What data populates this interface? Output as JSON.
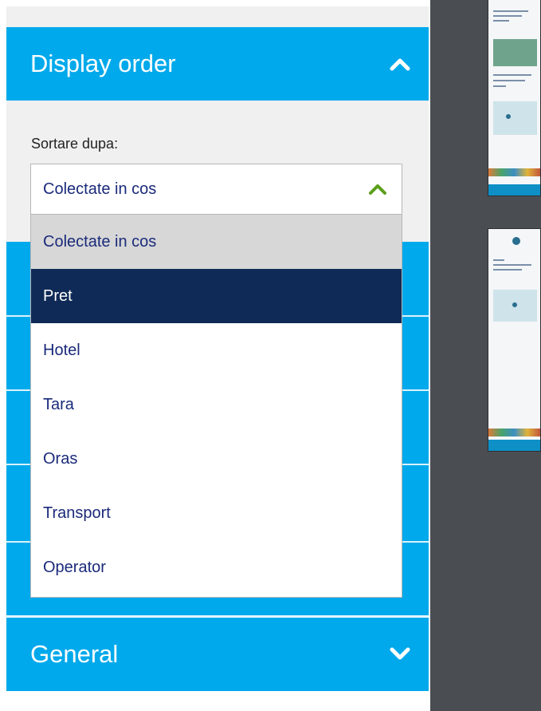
{
  "display_order": {
    "title": "Display order",
    "sort_label": "Sortare dupa:",
    "select": {
      "value": "Colectate in cos",
      "options": [
        "Colectate in cos",
        "Pret",
        "Hotel",
        "Tara",
        "Oras",
        "Transport",
        "Operator"
      ],
      "highlighted_option": "Pret"
    }
  },
  "general": {
    "title": "General"
  },
  "colors": {
    "accent_blue": "#00a9eb",
    "highlight_navy": "#0f2a56",
    "option_text": "#1a2a7a",
    "chevron_green": "#5a9e1a",
    "preview_background": "#4a4d51"
  },
  "icons": {
    "display_order_chevron": "chevron-up-icon",
    "select_chevron": "chevron-up-icon",
    "general_chevron": "chevron-down-icon"
  }
}
